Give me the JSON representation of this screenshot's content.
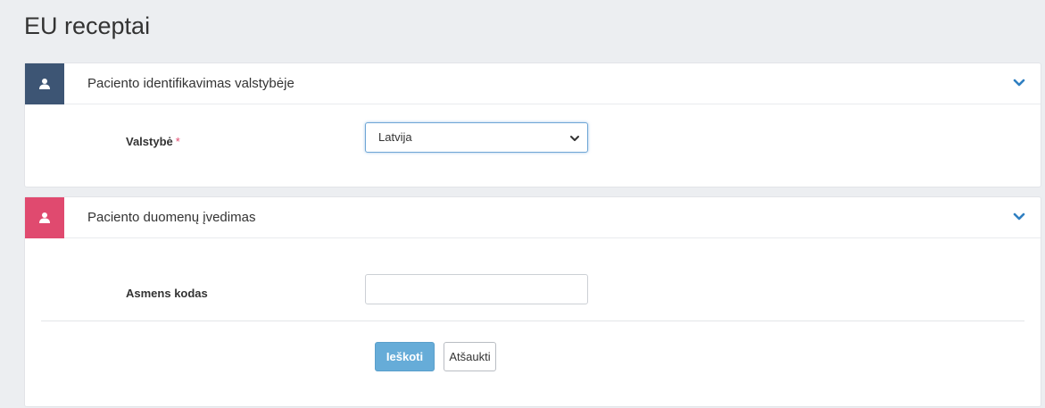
{
  "page": {
    "title": "EU receptai"
  },
  "panels": [
    {
      "title": "Paciento identifikavimas valstybėje",
      "icon": "user-icon",
      "color": "#3d5574",
      "fields": [
        {
          "label": "Valstybė",
          "required_mark": "*",
          "type": "select",
          "value": "Latvija"
        }
      ]
    },
    {
      "title": "Paciento duomenų įvedimas",
      "icon": "user-icon",
      "color": "#e04a6f",
      "fields": [
        {
          "label": "Asmens kodas",
          "type": "text",
          "value": ""
        }
      ],
      "buttons": {
        "search": "Ieškoti",
        "cancel": "Atšaukti"
      }
    }
  ],
  "colors": {
    "primary_button": "#66acd8",
    "select_focus": "#6fa6d6"
  }
}
